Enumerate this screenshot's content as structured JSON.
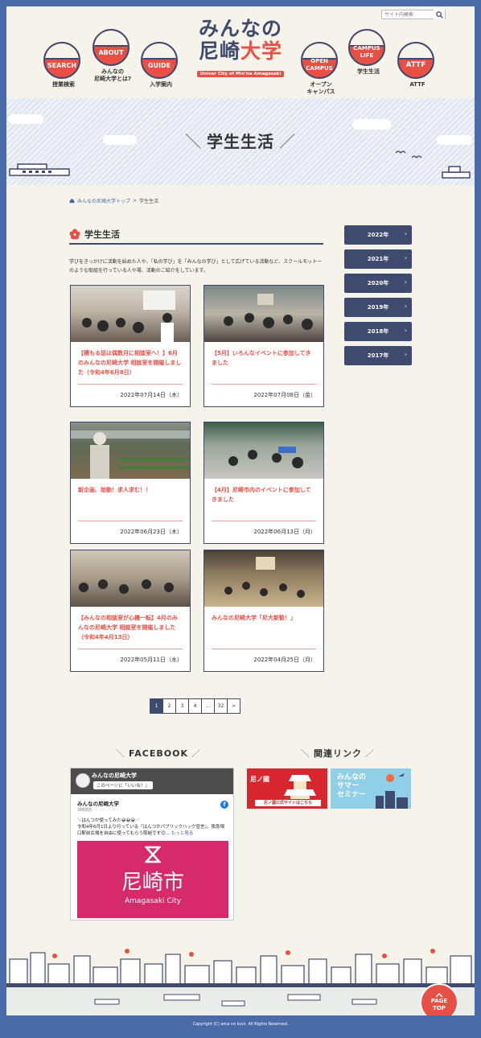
{
  "header": {
    "search_placeholder": "サイト内検索",
    "logo_line1": "みんなの",
    "logo_line2a": "尼崎",
    "logo_line2b": "大学",
    "logo_sub": "Univer City of Min'na Amagasaki",
    "nav": [
      {
        "badge": "SEARCH",
        "label": "授業検索"
      },
      {
        "badge": "ABOUT",
        "label": "みんなの\n尼崎大学とは?"
      },
      {
        "badge": "GUIDE",
        "label": "入学案内"
      },
      {
        "badge": "OPEN\nCAMPUS",
        "label": "オープン\nキャンパス"
      },
      {
        "badge": "CAMPUS\nLIFE",
        "label": "学生生活"
      },
      {
        "badge": "ATTF",
        "label": "ATTF"
      }
    ]
  },
  "hero": {
    "title": "学生生活"
  },
  "breadcrumb": {
    "home": "みんなの尼崎大学トップ",
    "sep": ">",
    "current": "学生生活"
  },
  "section": {
    "title": "学生生活",
    "intro": "学びをきっかけに活動を始めた人や、「私の学び」を「みんなの学び」として広げている活動など、スクールモットーのような取組を行っている人や場、活動のご紹介をしています。"
  },
  "cards": [
    {
      "title": "【積もる話は偶数月に相談室へ！】6月のみんなの尼崎大学 相談室を開催しました（令和4年6月8日）",
      "date": "2022年07月14日（木）"
    },
    {
      "title": "【5月】いろんなイベントに参加してきました",
      "date": "2022年07月08日（金）"
    },
    {
      "title": "新企画、始動！求人求む！！",
      "date": "2022年06月23日（木）"
    },
    {
      "title": "【4月】尼崎市内のイベントに参加してきました",
      "date": "2022年06月13日（月）"
    },
    {
      "title": "【みんなの相談室が心機一転】4月のみんなの尼崎大学 相談室を開催しました（令和4年4月13日）",
      "date": "2022年05月11日（水）"
    },
    {
      "title": "みんなの尼崎大学「尼大新歓！」",
      "date": "2022年04月25日（月）"
    }
  ],
  "years": [
    "2022年",
    "2021年",
    "2020年",
    "2019年",
    "2018年",
    "2017年"
  ],
  "pager": [
    "1",
    "2",
    "3",
    "4",
    "…",
    "32",
    ">"
  ],
  "facebook": {
    "heading": "FACEBOOK",
    "page_name": "みんなの尼崎大学",
    "like_label": "このページに「いいね！」",
    "post_author": "みんなの尼崎大学",
    "post_date": "3時間前",
    "post_text": "＼はんつか使ってみた😀😀😀／\n令和4年6月1日より行っている『はんつかパブリックハック宣言』。阪急塚口駅前広場を自由に使ってもらう取組です😊...",
    "more": "もっと見る",
    "image_jp": "尼崎市",
    "image_en": "Amagasaki City",
    "fb_letter": "f"
  },
  "links": {
    "heading": "関連リンク",
    "banner1_title": "尼ノ國",
    "banner1_sub": "尼ノ國公式サイトはこちら",
    "banner2_title": "みんなの\nサマー\nセミナー"
  },
  "pagetop": "PAGE\nTOP",
  "copyright": "Copyright (C) ama no kuni. All Rights Reserved."
}
